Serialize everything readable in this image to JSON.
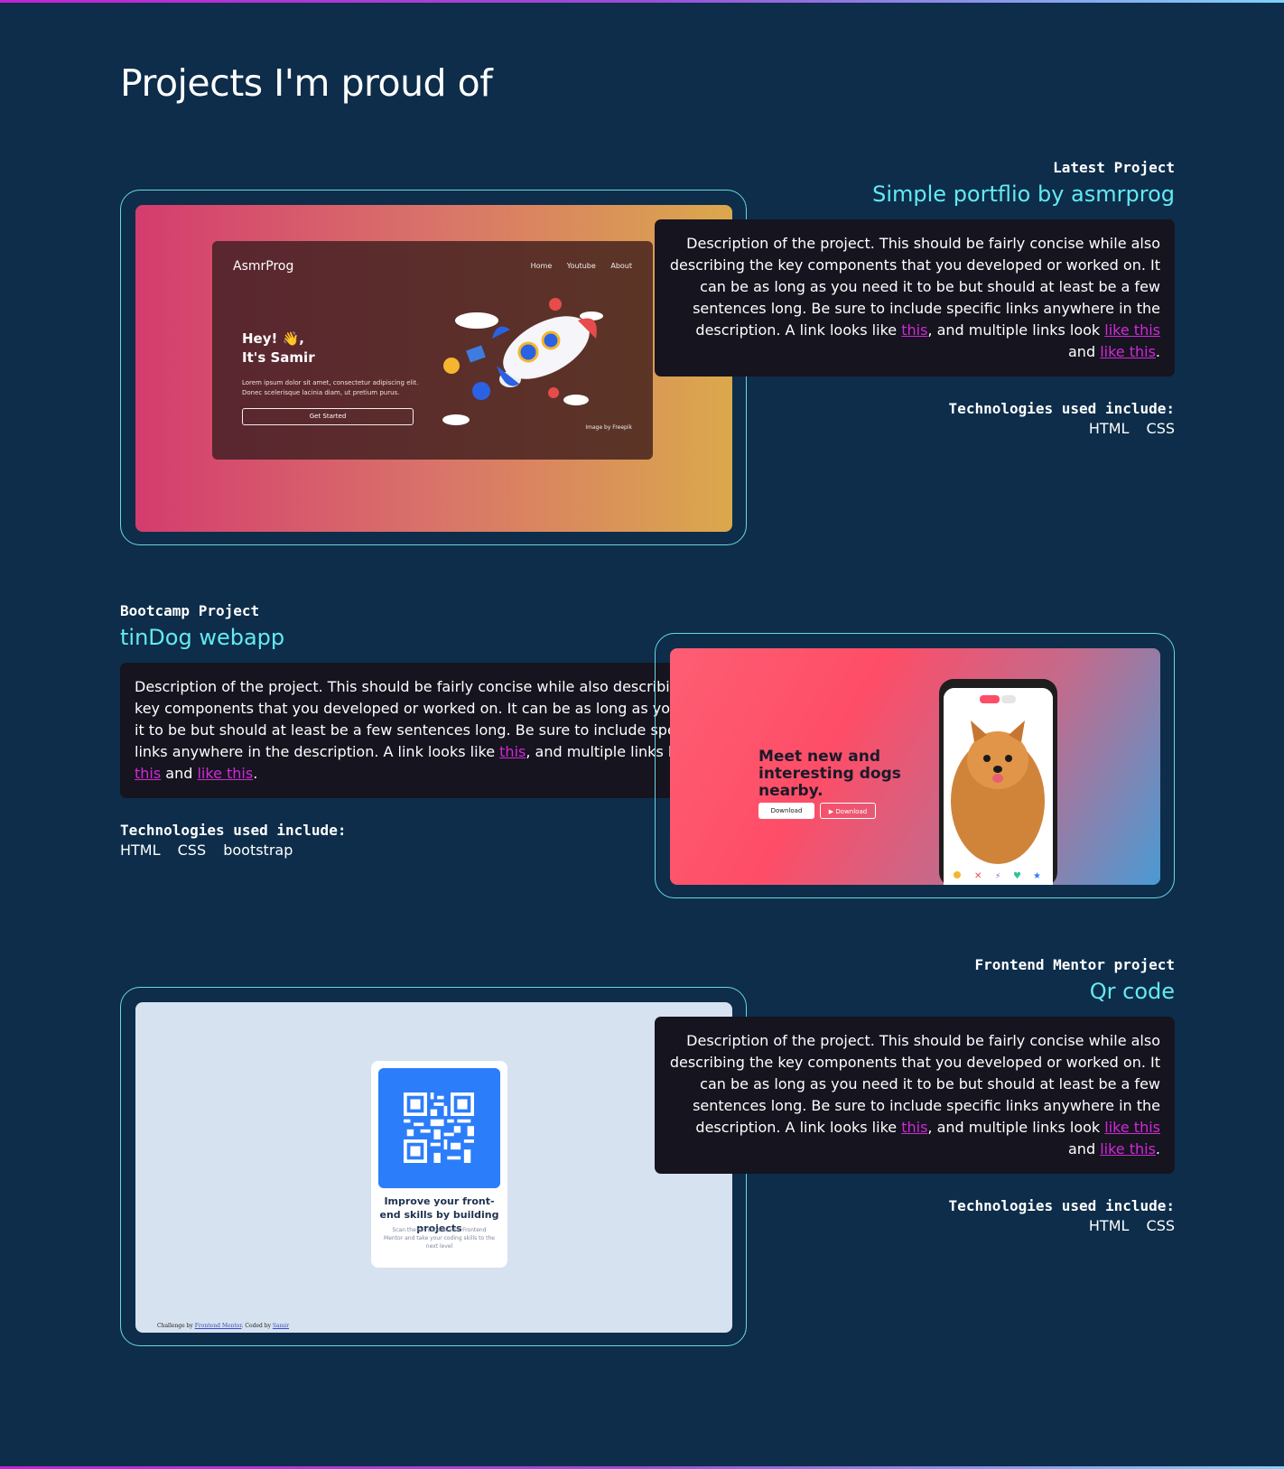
{
  "heading": "Projects I'm proud of",
  "link_color": "#d029d9",
  "accent_color": "#64e9f2",
  "projects": [
    {
      "eyebrow": "Latest Project",
      "title": "Simple portflio by asmrprog",
      "desc_text": "Description of the project. This should be fairly concise while also describing the key components that you developed or worked on. It can be as long as you need it to be but should at least be a few sentences long. Be sure to include specific links anywhere in the description. A link looks like ",
      "link1": "this",
      "desc_mid": ", and multiple links look ",
      "link2": "like this",
      "desc_and": " and ",
      "link3": "like this",
      "desc_end": ".",
      "tech_heading": "Technologies used include:",
      "tech": [
        "HTML",
        "CSS"
      ],
      "screenshot": {
        "brand": "AsmrProg",
        "nav": [
          "Home",
          "Youtube",
          "About"
        ],
        "hey_line1": "Hey! 👋,",
        "hey_line2": "It's Samir",
        "lorem": "Lorem ipsum dolor sit amet, consectetur adipiscing elit. Donec scelerisque lacinia diam, ut pretium purus.",
        "button": "Get Started",
        "credit": "Image by Freepik"
      }
    },
    {
      "eyebrow": "Bootcamp Project",
      "title": "tinDog webapp",
      "desc_text": "Description of the project. This should be fairly concise while also describing the key components that you developed or worked on. It can be as long as you need it to be but should at least be a few sentences long. Be sure to include specific links anywhere in the description. A link looks like ",
      "link1": "this",
      "desc_mid": ", and multiple links look ",
      "link2": "like this",
      "desc_and": " and ",
      "link3": "like this",
      "desc_end": ".",
      "tech_heading": "Technologies used include:",
      "tech": [
        "HTML",
        "CSS",
        "bootstrap"
      ],
      "screenshot": {
        "tagline": "Meet new and interesting dogs nearby.",
        "download1": " Download",
        "download2": "▶ Download"
      }
    },
    {
      "eyebrow": "Frontend Mentor project",
      "title": "Qr code",
      "desc_text": "Description of the project. This should be fairly concise while also describing the key components that you developed or worked on. It can be as long as you need it to be but should at least be a few sentences long. Be sure to include specific links anywhere in the description. A link looks like ",
      "link1": "this",
      "desc_mid": ", and multiple links look ",
      "link2": "like this",
      "desc_and": " and ",
      "link3": "like this",
      "desc_end": ".",
      "tech_heading": "Technologies used include:",
      "tech": [
        "HTML",
        "CSS"
      ],
      "screenshot": {
        "card_title": "Improve your front-end skills by building projects",
        "card_sub": "Scan the QR code to visit Frontend Mentor and take your coding skills to the next level",
        "attr_pre": "Challenge by ",
        "attr_link1": "Frontend Mentor",
        "attr_mid": ". Coded by ",
        "attr_link2": "Samir"
      }
    }
  ]
}
